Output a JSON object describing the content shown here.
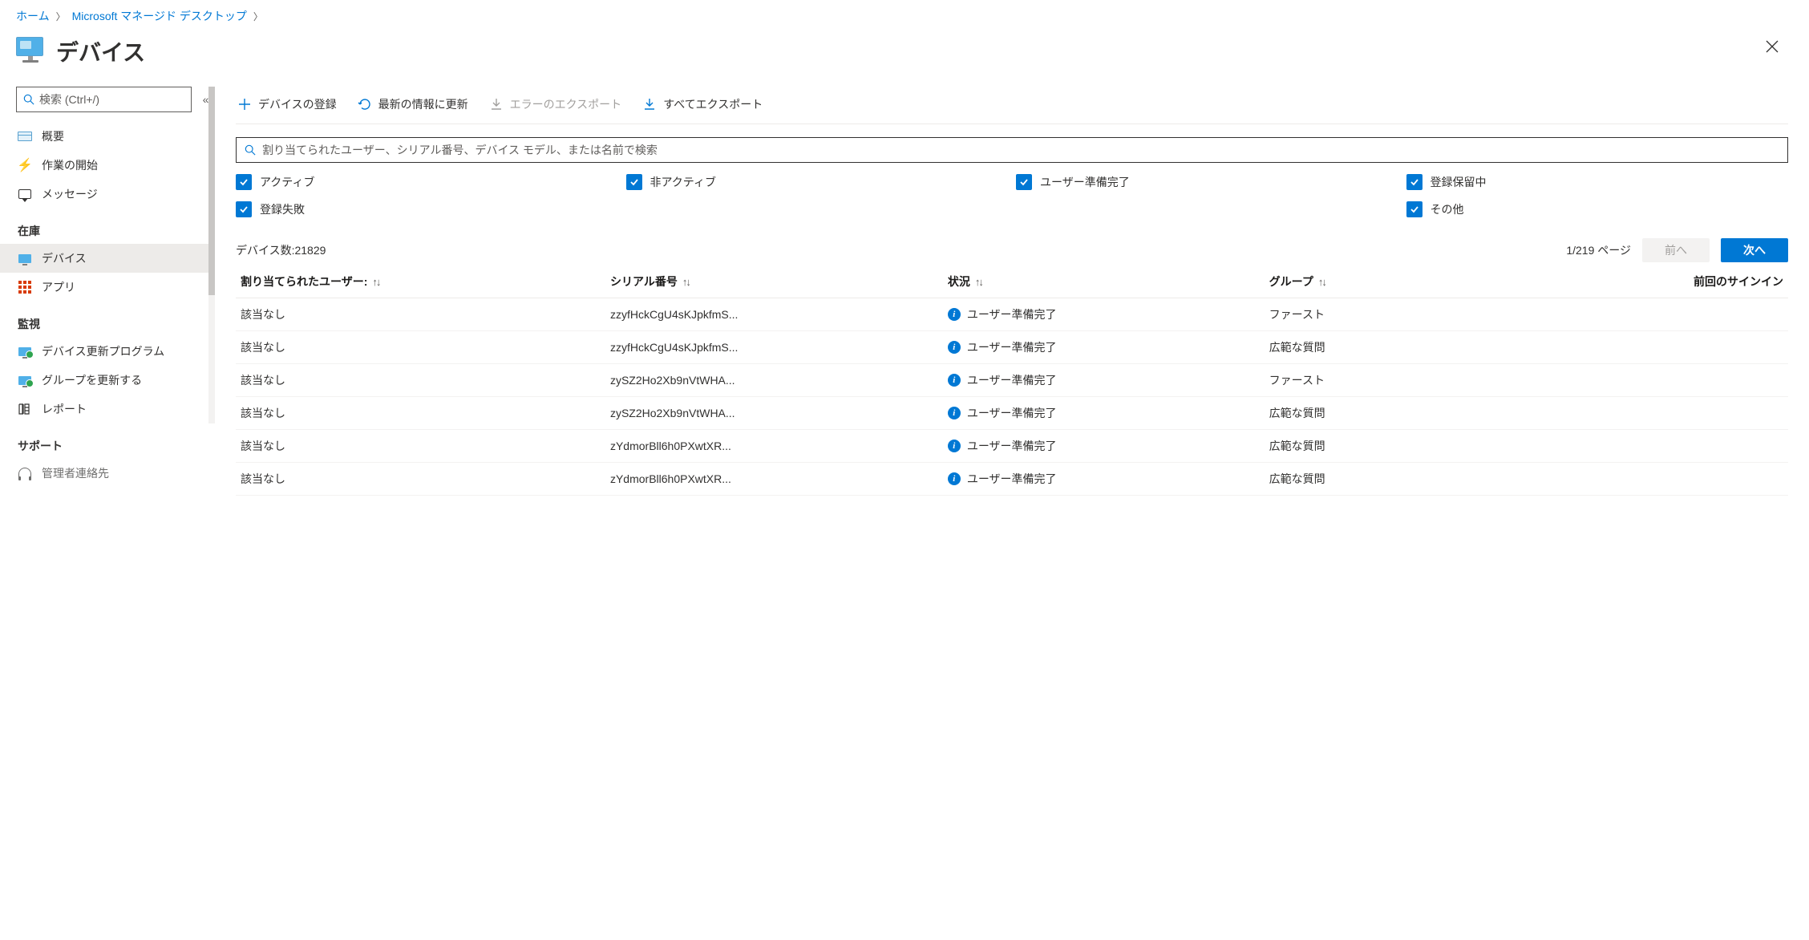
{
  "breadcrumb": {
    "home": "ホーム",
    "mmd": "Microsoft マネージド デスクトップ"
  },
  "header": {
    "title": "デバイス"
  },
  "sidebar": {
    "search_placeholder": "検索 (Ctrl+/)",
    "items": {
      "overview": "概要",
      "getstarted": "作業の開始",
      "messages": "メッセージ"
    },
    "sections": {
      "inventory": "在庫",
      "monitoring": "監視",
      "support": "サポート"
    },
    "inventory": {
      "devices": "デバイス",
      "apps": "アプリ"
    },
    "monitoring": {
      "device_updates": "デバイス更新プログラム",
      "group_updates": "グループを更新する",
      "reports": "レポート"
    },
    "support": {
      "admin_contacts": "管理者連絡先"
    }
  },
  "toolbar": {
    "register": "デバイスの登録",
    "refresh": "最新の情報に更新",
    "export_errors": "エラーのエクスポート",
    "export_all": "すべてエクスポート"
  },
  "filters": {
    "search_placeholder": "割り当てられたユーザー、シリアル番号、デバイス モデル、または名前で検索",
    "active": "アクティブ",
    "inactive": "非アクティブ",
    "user_ready": "ユーザー準備完了",
    "reg_pending": "登録保留中",
    "reg_failed": "登録失敗",
    "other": "その他"
  },
  "count": {
    "label": "デバイス数:21829"
  },
  "pager": {
    "info": "1/219 ページ",
    "prev": "前へ",
    "next": "次へ"
  },
  "columns": {
    "user": "割り当てられたユーザー:",
    "serial": "シリアル番号",
    "status": "状況",
    "group": "グループ",
    "last_signin": "前回のサインイン"
  },
  "rows": [
    {
      "user": "該当なし",
      "serial": "zzyfHckCgU4sKJpkfmS...",
      "status": "ユーザー準備完了",
      "group": "ファースト"
    },
    {
      "user": "該当なし",
      "serial": "zzyfHckCgU4sKJpkfmS...",
      "status": "ユーザー準備完了",
      "group": "広範な質問"
    },
    {
      "user": "該当なし",
      "serial": "zySZ2Ho2Xb9nVtWHA...",
      "status": "ユーザー準備完了",
      "group": "ファースト"
    },
    {
      "user": "該当なし",
      "serial": "zySZ2Ho2Xb9nVtWHA...",
      "status": "ユーザー準備完了",
      "group": "広範な質問"
    },
    {
      "user": "該当なし",
      "serial": "zYdmorBll6h0PXwtXR...",
      "status": "ユーザー準備完了",
      "group": "広範な質問"
    },
    {
      "user": "該当なし",
      "serial": "zYdmorBll6h0PXwtXR...",
      "status": "ユーザー準備完了",
      "group": "広範な質問"
    }
  ]
}
